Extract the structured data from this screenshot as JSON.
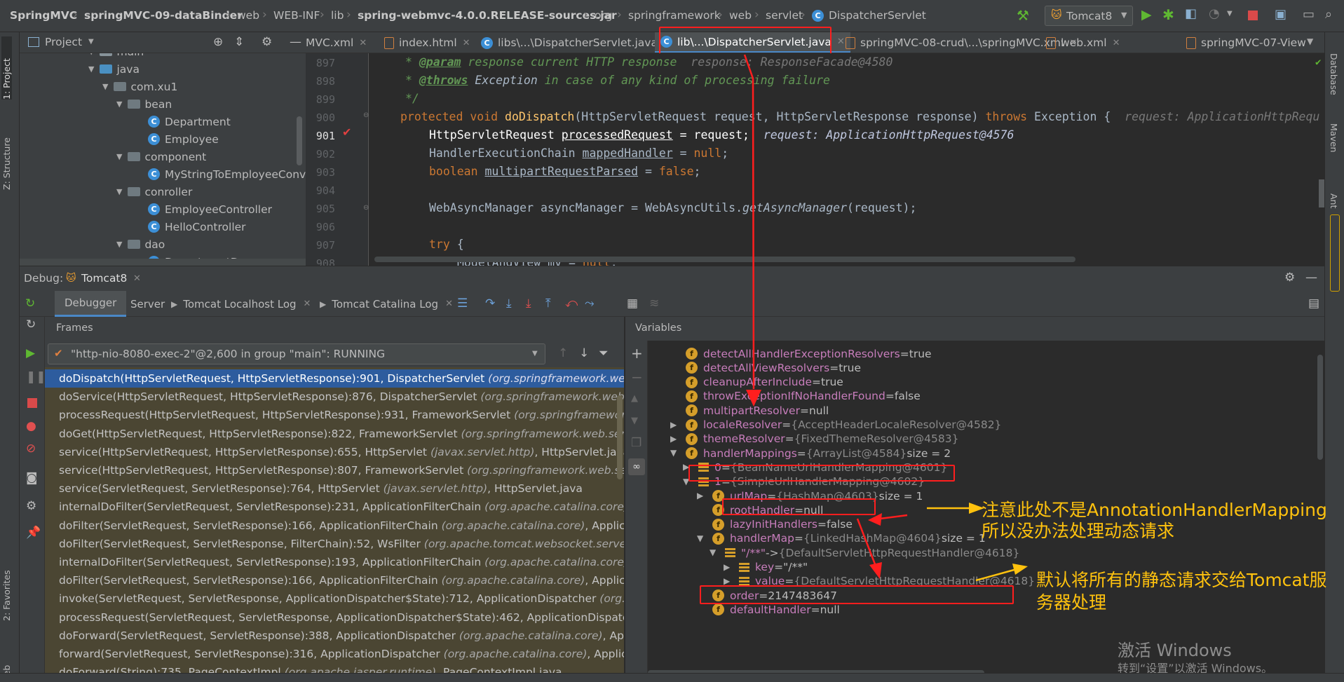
{
  "breadcrumb": {
    "items": [
      "SpringMVC",
      "springMVC-09-dataBinder",
      "web",
      "WEB-INF",
      "lib",
      "spring-webmvc-4.0.0.RELEASE-sources.jar",
      "org",
      "springframework",
      "web",
      "servlet",
      "DispatcherServlet"
    ],
    "bold": [
      0,
      1,
      5
    ]
  },
  "run_config": "Tomcat8",
  "left_strip": {
    "project": "1: Project",
    "structure": "Z: Structure",
    "favorites": "2: Favorites",
    "web": "Web"
  },
  "right_strip": {
    "database": "Database",
    "maven": "Maven",
    "ant": "Ant"
  },
  "project_panel": {
    "title": "Project",
    "tree": [
      {
        "label": "main",
        "level": 4,
        "type": "folder"
      },
      {
        "label": "java",
        "level": 5,
        "type": "folder",
        "expanded": true
      },
      {
        "label": "com.xu1",
        "level": 6,
        "type": "package",
        "expanded": true
      },
      {
        "label": "bean",
        "level": 7,
        "type": "package",
        "expanded": true
      },
      {
        "label": "Department",
        "level": 8,
        "type": "class"
      },
      {
        "label": "Employee",
        "level": 8,
        "type": "class"
      },
      {
        "label": "component",
        "level": 7,
        "type": "package",
        "expanded": true
      },
      {
        "label": "MyStringToEmployeeConve",
        "level": 8,
        "type": "class"
      },
      {
        "label": "conroller",
        "level": 7,
        "type": "package",
        "expanded": true
      },
      {
        "label": "EmployeeController",
        "level": 8,
        "type": "class"
      },
      {
        "label": "HelloController",
        "level": 8,
        "type": "class"
      },
      {
        "label": "dao",
        "level": 7,
        "type": "package",
        "expanded": true
      },
      {
        "label": "DepartmentDao",
        "level": 8,
        "type": "class"
      }
    ]
  },
  "editor_tabs": [
    {
      "label": "MVC.xml",
      "type": "xml"
    },
    {
      "label": "index.html",
      "type": "html"
    },
    {
      "label": "libs\\...\\DispatcherServlet.java",
      "type": "class"
    },
    {
      "label": "lib\\...\\DispatcherServlet.java",
      "type": "class",
      "active": true
    },
    {
      "label": "springMVC-08-crud\\...\\springMVC.xml",
      "type": "xml"
    },
    {
      "label": "web.xml",
      "type": "xml"
    },
    {
      "label": "springMVC-07-View",
      "type": "xml"
    }
  ],
  "code": {
    "lines": [
      "897",
      "898",
      "899",
      "900",
      "901",
      "902",
      "903",
      "904",
      "905",
      "906",
      "907",
      "908"
    ],
    "current_line": "901",
    "l897": {
      "star": "* ",
      "tag": "@param",
      "text": " response current HTTP response",
      "hint": "  response: ResponseFacade@4580"
    },
    "l898": {
      "star": "* ",
      "tag": "@throws",
      "pre": " ",
      "exc": "Exception",
      "text": " in case of any kind of processing failure"
    },
    "l899": {
      "text": "*/"
    },
    "l900": {
      "kw1": "protected void ",
      "fn": "doDispatch",
      "a": "(HttpServletRequest request, HttpServletResponse response) ",
      "kw2": "throws ",
      "b": "Exception {",
      "hint": "  request: ApplicationHttpRequ"
    },
    "l901": {
      "a": "HttpServletRequest ",
      "v": "processedRequest",
      "b": " = request;",
      "hint": "  request: ApplicationHttpRequest@4576"
    },
    "l902": {
      "a": "HandlerExecutionChain ",
      "v": "mappedHandler",
      "b": " = ",
      "kw": "null",
      "c": ";"
    },
    "l903": {
      "kw": "boolean ",
      "v": "multipartRequestParsed",
      "b": " = ",
      "kw2": "false",
      "c": ";"
    },
    "l905": {
      "a": "WebAsyncManager asyncManager = WebAsyncUtils.",
      "it": "getAsyncManager",
      "b": "(request);"
    },
    "l907": {
      "kw": "try",
      "b": " {"
    },
    "l908": {
      "a": "ModelAndView mv = ",
      "kw": "null",
      "b": ";"
    }
  },
  "debug": {
    "title": "Debug:",
    "session": "Tomcat8",
    "tabs": [
      "Debugger",
      "Server",
      "Tomcat Localhost Log",
      "Tomcat Catalina Log"
    ],
    "frames_label": "Frames",
    "variables_label": "Variables",
    "thread": "\"http-nio-8080-exec-2\"@2,600 in group \"main\": RUNNING",
    "frames": [
      {
        "m": "doDispatch(HttpServletRequest, HttpServletResponse):901, DispatcherServlet ",
        "p": "(org.springframework.web.servl"
      },
      {
        "m": "doService(HttpServletRequest, HttpServletResponse):876, DispatcherServlet ",
        "p": "(org.springframework.web.servle"
      },
      {
        "m": "processRequest(HttpServletRequest, HttpServletResponse):931, FrameworkServlet ",
        "p": "(org.springframework.web"
      },
      {
        "m": "doGet(HttpServletRequest, HttpServletResponse):822, FrameworkServlet ",
        "p": "(org.springframework.web.servlet), F"
      },
      {
        "m": "service(HttpServletRequest, HttpServletResponse):655, HttpServlet ",
        "p": "(javax.servlet.http)",
        "t": ", HttpServlet.java"
      },
      {
        "m": "service(HttpServletRequest, HttpServletResponse):807, FrameworkServlet ",
        "p": "(org.springframework.web.servlet),"
      },
      {
        "m": "service(ServletRequest, ServletResponse):764, HttpServlet ",
        "p": "(javax.servlet.http)",
        "t": ", HttpServlet.java"
      },
      {
        "m": "internalDoFilter(ServletRequest, ServletResponse):231, ApplicationFilterChain ",
        "p": "(org.apache.catalina.core)",
        "t": ", Appli"
      },
      {
        "m": "doFilter(ServletRequest, ServletResponse):166, ApplicationFilterChain ",
        "p": "(org.apache.catalina.core)",
        "t": ", ApplicationFil"
      },
      {
        "m": "doFilter(ServletRequest, ServletResponse, FilterChain):52, WsFilter ",
        "p": "(org.apache.tomcat.websocket.server)",
        "t": ", WsFi"
      },
      {
        "m": "internalDoFilter(ServletRequest, ServletResponse):193, ApplicationFilterChain ",
        "p": "(org.apache.catalina.core)",
        "t": ", Appli"
      },
      {
        "m": "doFilter(ServletRequest, ServletResponse):166, ApplicationFilterChain ",
        "p": "(org.apache.catalina.core)",
        "t": ", ApplicationFil"
      },
      {
        "m": "invoke(ServletRequest, ServletResponse, ApplicationDispatcher$State):712, ApplicationDispatcher ",
        "p": "(org.apache"
      },
      {
        "m": "processRequest(ServletRequest, ServletResponse, ApplicationDispatcher$State):462, ApplicationDispatcher ",
        "p": "(org.a"
      },
      {
        "m": "doForward(ServletRequest, ServletResponse):388, ApplicationDispatcher ",
        "p": "(org.apache.catalina.core)",
        "t": ", Applicatio"
      },
      {
        "m": "forward(ServletRequest, ServletResponse):316, ApplicationDispatcher ",
        "p": "(org.apache.catalina.core)",
        "t": ", ApplicationDi"
      },
      {
        "m": "doForward(String):735, PageContextImpl ",
        "p": "(org.apache.jasper.runtime)",
        "t": ", PageContextImpl.java"
      }
    ],
    "variables": [
      {
        "n": "detectAllHandlerExceptionResolvers",
        "s": " = ",
        "v": "true",
        "lvl": 0,
        "icon": "f"
      },
      {
        "n": "detectAllViewResolvers",
        "s": " = ",
        "v": "true",
        "lvl": 0,
        "icon": "f"
      },
      {
        "n": "cleanupAfterInclude",
        "s": " = ",
        "v": "true",
        "lvl": 0,
        "icon": "f"
      },
      {
        "n": "throwExceptionIfNoHandlerFound",
        "s": " = ",
        "v": "false",
        "lvl": 0,
        "icon": "f"
      },
      {
        "n": "multipartResolver",
        "s": " = ",
        "v": "null",
        "lvl": 0,
        "icon": "f"
      },
      {
        "n": "localeResolver",
        "s": " = ",
        "g": "{AcceptHeaderLocaleResolver@4582}",
        "lvl": 0,
        "icon": "f",
        "arrow": "right"
      },
      {
        "n": "themeResolver",
        "s": " = ",
        "g": "{FixedThemeResolver@4583}",
        "lvl": 0,
        "icon": "f",
        "arrow": "right"
      },
      {
        "n": "handlerMappings",
        "s": " = ",
        "g": "{ArrayList@4584}",
        "v": "  size = 2",
        "lvl": 0,
        "icon": "f",
        "arrow": "down"
      },
      {
        "n": "0",
        "s": " = ",
        "g": "{BeanNameUrlHandlerMapping@4601}",
        "lvl": 1,
        "icon": "e",
        "arrow": "right"
      },
      {
        "n": "1",
        "s": " = ",
        "g": "{SimpleUrlHandlerMapping@4602}",
        "lvl": 1,
        "icon": "e",
        "arrow": "down"
      },
      {
        "n": "urlMap",
        "s": " = ",
        "g": "{HashMap@4603}",
        "v": "  size = 1",
        "lvl": 2,
        "icon": "f",
        "arrow": "right"
      },
      {
        "n": "rootHandler",
        "s": " = ",
        "v": "null",
        "lvl": 2,
        "icon": "f"
      },
      {
        "n": "lazyInitHandlers",
        "s": " = ",
        "v": "false",
        "lvl": 2,
        "icon": "f"
      },
      {
        "n": "handlerMap",
        "s": " = ",
        "g": "{LinkedHashMap@4604}",
        "v": "  size = 1",
        "lvl": 2,
        "icon": "f",
        "arrow": "down"
      },
      {
        "n": "\"/**\"",
        "s": " -> ",
        "g": "{DefaultServletHttpRequestHandler@4618}",
        "lvl": 3,
        "icon": "e",
        "arrow": "down"
      },
      {
        "n": "key",
        "s": " = ",
        "v": "\"/**\"",
        "lvl": 4,
        "icon": "e",
        "arrow": "right"
      },
      {
        "n": "value",
        "s": " = ",
        "g": "{DefaultServletHttpRequestHandler@4618}",
        "lvl": 4,
        "icon": "e",
        "arrow": "right"
      },
      {
        "n": "order",
        "s": " = ",
        "v": "2147483647",
        "lvl": 2,
        "icon": "f"
      },
      {
        "n": "defaultHandler",
        "s": " = ",
        "v": "null",
        "lvl": 2,
        "icon": "f"
      }
    ]
  },
  "annotations": {
    "a1_line1": "注意此处不是AnnotationHandlerMapping",
    "a1_line2": "所以没办法处理动态请求",
    "a2_line1": "默认将所有的静态请求交给Tomcat服",
    "a2_line2": "务器处理"
  },
  "watermark": {
    "line1": "激活 Windows",
    "line2": "转到“设置”以激活 Windows。"
  },
  "colors": {
    "annotation_box": "#ff1e1e",
    "annotation_text": "#ffc20e",
    "selection": "#2d5c9e",
    "frames_bg": "#4b4633"
  }
}
